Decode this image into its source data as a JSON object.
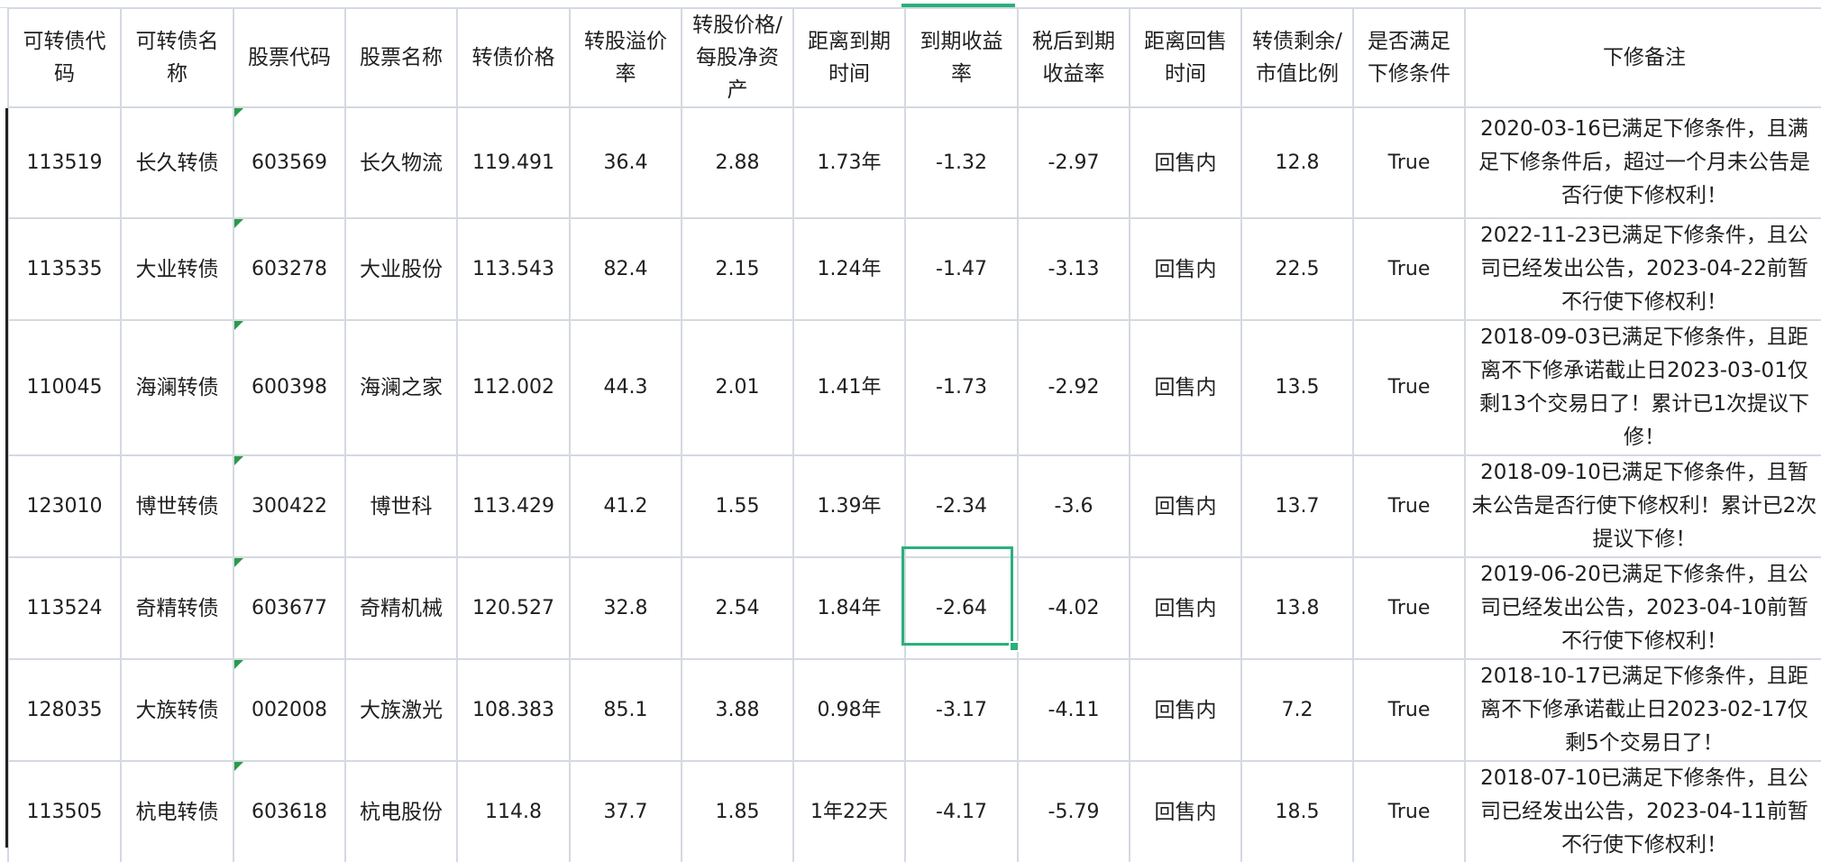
{
  "headers": [
    "可转债代码",
    "可转债名称",
    "股票代码",
    "股票名称",
    "转债价格",
    "转股溢价率",
    "转股价格/每股净资产",
    "距离到期时间",
    "到期收益率",
    "税后到期收益率",
    "距离回售时间",
    "转债剩余/市值比例",
    "是否满足下修条件",
    "下修备注"
  ],
  "rows": [
    [
      "113519",
      "长久转债",
      "603569",
      "长久物流",
      "119.491",
      "36.4",
      "2.88",
      "1.73年",
      "-1.32",
      "-2.97",
      "回售内",
      "12.8",
      "True",
      "2020-03-16已满足下修条件，且满足下修条件后，超过一个月未公告是否行使下修权利！"
    ],
    [
      "113535",
      "大业转债",
      "603278",
      "大业股份",
      "113.543",
      "82.4",
      "2.15",
      "1.24年",
      "-1.47",
      "-3.13",
      "回售内",
      "22.5",
      "True",
      "2022-11-23已满足下修条件，且公司已经发出公告，2023-04-22前暂不行使下修权利！"
    ],
    [
      "110045",
      "海澜转债",
      "600398",
      "海澜之家",
      "112.002",
      "44.3",
      "2.01",
      "1.41年",
      "-1.73",
      "-2.92",
      "回售内",
      "13.5",
      "True",
      "2018-09-03已满足下修条件，且距离不下修承诺截止日2023-03-01仅剩13个交易日了！累计已1次提议下修！"
    ],
    [
      "123010",
      "博世转债",
      "300422",
      "博世科",
      "113.429",
      "41.2",
      "1.55",
      "1.39年",
      "-2.34",
      "-3.6",
      "回售内",
      "13.7",
      "True",
      "2018-09-10已满足下修条件，且暂未公告是否行使下修权利！累计已2次提议下修！"
    ],
    [
      "113524",
      "奇精转债",
      "603677",
      "奇精机械",
      "120.527",
      "32.8",
      "2.54",
      "1.84年",
      "-2.64",
      "-4.02",
      "回售内",
      "13.8",
      "True",
      "2019-06-20已满足下修条件，且公司已经发出公告，2023-04-10前暂不行使下修权利！"
    ],
    [
      "128035",
      "大族转债",
      "002008",
      "大族激光",
      "108.383",
      "85.1",
      "3.88",
      "0.98年",
      "-3.17",
      "-4.11",
      "回售内",
      "7.2",
      "True",
      "2018-10-17已满足下修条件，且距离不下修承诺截止日2023-02-17仅剩5个交易日了！"
    ],
    [
      "113505",
      "杭电转债",
      "603618",
      "杭电股份",
      "114.8",
      "37.7",
      "1.85",
      "1年22天",
      "-4.17",
      "-5.79",
      "回售内",
      "18.5",
      "True",
      "2018-07-10已满足下修条件，且公司已经发出公告，2023-04-11前暂不行使下修权利！"
    ]
  ],
  "colors": {
    "grid_line": "#d4d9e2",
    "selection": "#2ab07c",
    "note_marker": "#2a9a4a"
  },
  "icons": {
    "comment_marker": "green-triangle-corner"
  }
}
